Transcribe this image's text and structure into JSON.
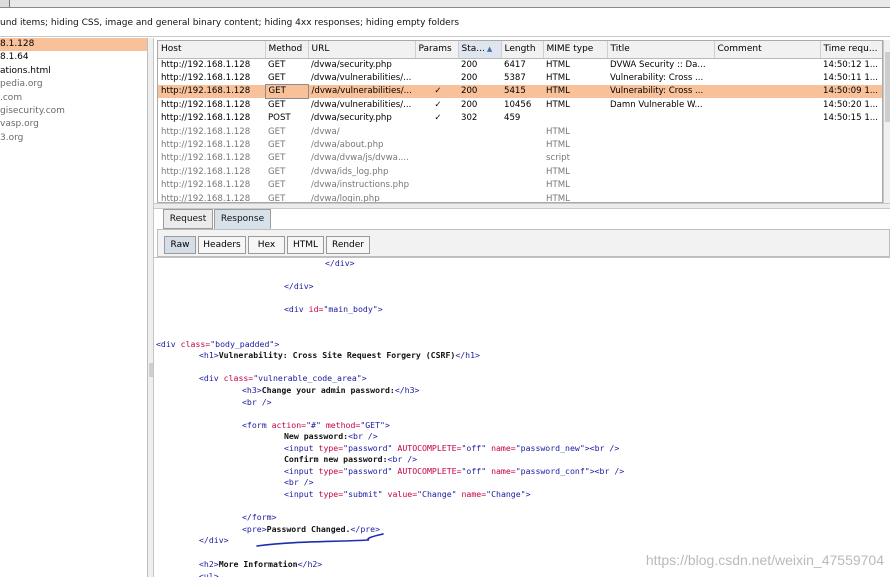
{
  "filter_bar": {
    "text": "und items;  hiding CSS, image and general binary content;  hiding 4xx responses;  hiding empty folders"
  },
  "site_tree": [
    {
      "label": "8.1.128",
      "selected": true
    },
    {
      "label": "8.1.64"
    },
    {
      "label": "ations.html"
    },
    {
      "label": "pedia.org",
      "dim": true
    },
    {
      "label": ".com",
      "dim": true
    },
    {
      "label": "gisecurity.com",
      "dim": true
    },
    {
      "label": "vasp.org",
      "dim": true
    },
    {
      "label": "3.org",
      "dim": true
    }
  ],
  "history_table": {
    "columns": [
      "Host",
      "Method",
      "URL",
      "Params",
      "Sta...",
      "Length",
      "MIME type",
      "Title",
      "Comment",
      "Time requ..."
    ],
    "sorted_column": "Sta...",
    "rows": [
      {
        "host": "http://192.168.1.128",
        "method": "GET",
        "url": "/dvwa/security.php",
        "params": "",
        "status": "200",
        "length": "6417",
        "mime": "HTML",
        "title": "DVWA Security :: Da...",
        "comment": "",
        "time": "14:50:12 1..."
      },
      {
        "host": "http://192.168.1.128",
        "method": "GET",
        "url": "/dvwa/vulnerabilities/...",
        "params": "",
        "status": "200",
        "length": "5387",
        "mime": "HTML",
        "title": "Vulnerability: Cross ...",
        "comment": "",
        "time": "14:50:11 1..."
      },
      {
        "host": "http://192.168.1.128",
        "method": "GET",
        "url": "/dvwa/vulnerabilities/...",
        "params": "✓",
        "status": "200",
        "length": "5415",
        "mime": "HTML",
        "title": "Vulnerability: Cross ...",
        "comment": "",
        "time": "14:50:09 1...",
        "selected": true
      },
      {
        "host": "http://192.168.1.128",
        "method": "GET",
        "url": "/dvwa/vulnerabilities/...",
        "params": "✓",
        "status": "200",
        "length": "10456",
        "mime": "HTML",
        "title": "Damn Vulnerable W...",
        "comment": "",
        "time": "14:50:20 1..."
      },
      {
        "host": "http://192.168.1.128",
        "method": "POST",
        "url": "/dvwa/security.php",
        "params": "✓",
        "status": "302",
        "length": "459",
        "mime": "",
        "title": "",
        "comment": "",
        "time": "14:50:15 1..."
      },
      {
        "host": "http://192.168.1.128",
        "method": "GET",
        "url": "/dvwa/",
        "params": "",
        "status": "",
        "length": "",
        "mime": "HTML",
        "title": "",
        "comment": "",
        "time": "",
        "dim": true
      },
      {
        "host": "http://192.168.1.128",
        "method": "GET",
        "url": "/dvwa/about.php",
        "params": "",
        "status": "",
        "length": "",
        "mime": "HTML",
        "title": "",
        "comment": "",
        "time": "",
        "dim": true
      },
      {
        "host": "http://192.168.1.128",
        "method": "GET",
        "url": "/dvwa/dvwa/js/dvwa....",
        "params": "",
        "status": "",
        "length": "",
        "mime": "script",
        "title": "",
        "comment": "",
        "time": "",
        "dim": true
      },
      {
        "host": "http://192.168.1.128",
        "method": "GET",
        "url": "/dvwa/ids_log.php",
        "params": "",
        "status": "",
        "length": "",
        "mime": "HTML",
        "title": "",
        "comment": "",
        "time": "",
        "dim": true
      },
      {
        "host": "http://192.168.1.128",
        "method": "GET",
        "url": "/dvwa/instructions.php",
        "params": "",
        "status": "",
        "length": "",
        "mime": "HTML",
        "title": "",
        "comment": "",
        "time": "",
        "dim": true
      },
      {
        "host": "http://192.168.1.128",
        "method": "GET",
        "url": "/dvwa/login.php",
        "params": "",
        "status": "",
        "length": "",
        "mime": "HTML",
        "title": "",
        "comment": "",
        "time": "",
        "dim": true
      }
    ]
  },
  "message_tabs": {
    "request": "Request",
    "response": "Response",
    "active": "Response"
  },
  "view_tabs": {
    "raw": "Raw",
    "headers": "Headers",
    "hex": "Hex",
    "html": "HTML",
    "render": "Render",
    "active": "Raw"
  },
  "response_lines": [
    [
      {
        "t": "tag",
        "s": "</div>"
      }
    ],
    [
      {
        "t": "tag",
        "s": "</div>"
      }
    ],
    [
      {
        "t": "tag",
        "s": "<div "
      },
      {
        "t": "attr",
        "s": "id="
      },
      {
        "t": "val",
        "s": "\"main_body\""
      },
      {
        "t": "tag",
        "s": ">"
      }
    ],
    [
      {
        "t": "tag",
        "s": "<div "
      },
      {
        "t": "attr",
        "s": "class="
      },
      {
        "t": "val",
        "s": "\"body_padded\""
      },
      {
        "t": "tag",
        "s": ">"
      }
    ],
    [
      {
        "t": "tag",
        "s": "<h1>"
      },
      {
        "t": "txt",
        "s": "Vulnerability: Cross Site Request Forgery (CSRF)"
      },
      {
        "t": "tag",
        "s": "</h1>"
      }
    ],
    [
      {
        "t": "tag",
        "s": "<div "
      },
      {
        "t": "attr",
        "s": "class="
      },
      {
        "t": "val",
        "s": "\"vulnerable_code_area\""
      },
      {
        "t": "tag",
        "s": ">"
      }
    ],
    [
      {
        "t": "tag",
        "s": "<h3>"
      },
      {
        "t": "txt",
        "s": "Change your admin password:"
      },
      {
        "t": "tag",
        "s": "</h3>"
      }
    ],
    [
      {
        "t": "tag",
        "s": "<br />"
      }
    ],
    [
      {
        "t": "tag",
        "s": "<form "
      },
      {
        "t": "attr",
        "s": "action="
      },
      {
        "t": "val",
        "s": "\"#\" "
      },
      {
        "t": "attr",
        "s": "method="
      },
      {
        "t": "val",
        "s": "\"GET\""
      },
      {
        "t": "tag",
        "s": ">"
      }
    ],
    [
      {
        "t": "txt",
        "s": "New password:"
      },
      {
        "t": "tag",
        "s": "<br />"
      }
    ],
    [
      {
        "t": "tag",
        "s": "<input "
      },
      {
        "t": "attr",
        "s": "type="
      },
      {
        "t": "val",
        "s": "\"password\" "
      },
      {
        "t": "attr",
        "s": "AUTOCOMPLETE="
      },
      {
        "t": "val",
        "s": "\"off\" "
      },
      {
        "t": "attr",
        "s": "name="
      },
      {
        "t": "val",
        "s": "\"password_new\""
      },
      {
        "t": "tag",
        "s": "><br />"
      }
    ],
    [
      {
        "t": "txt",
        "s": "Confirm new password:"
      },
      {
        "t": "tag",
        "s": "<br />"
      }
    ],
    [
      {
        "t": "tag",
        "s": "<input "
      },
      {
        "t": "attr",
        "s": "type="
      },
      {
        "t": "val",
        "s": "\"password\" "
      },
      {
        "t": "attr",
        "s": "AUTOCOMPLETE="
      },
      {
        "t": "val",
        "s": "\"off\" "
      },
      {
        "t": "attr",
        "s": "name="
      },
      {
        "t": "val",
        "s": "\"password_conf\""
      },
      {
        "t": "tag",
        "s": "><br />"
      }
    ],
    [
      {
        "t": "tag",
        "s": "<br />"
      }
    ],
    [
      {
        "t": "tag",
        "s": "<input "
      },
      {
        "t": "attr",
        "s": "type="
      },
      {
        "t": "val",
        "s": "\"submit\" "
      },
      {
        "t": "attr",
        "s": "value="
      },
      {
        "t": "val",
        "s": "\"Change\" "
      },
      {
        "t": "attr",
        "s": "name="
      },
      {
        "t": "val",
        "s": "\"Change\""
      },
      {
        "t": "tag",
        "s": ">"
      }
    ],
    [
      {
        "t": "tag",
        "s": "</form>"
      }
    ],
    [
      {
        "t": "tag",
        "s": "<pre>"
      },
      {
        "t": "txt",
        "s": "Password Changed."
      },
      {
        "t": "tag",
        "s": "</pre>"
      }
    ],
    [
      {
        "t": "tag",
        "s": "</div>"
      }
    ],
    [
      {
        "t": "tag",
        "s": "<h2>"
      },
      {
        "t": "txt",
        "s": "More Information"
      },
      {
        "t": "tag",
        "s": "</h2>"
      }
    ],
    [
      {
        "t": "tag",
        "s": "<ul>"
      }
    ]
  ],
  "watermark": "https://blog.csdn.net/weixin_47559704",
  "colors": {
    "selection": "#f9c19a",
    "tag": "#1a1a9e",
    "attr": "#c4004a",
    "annotation": "#1d2fb0"
  }
}
